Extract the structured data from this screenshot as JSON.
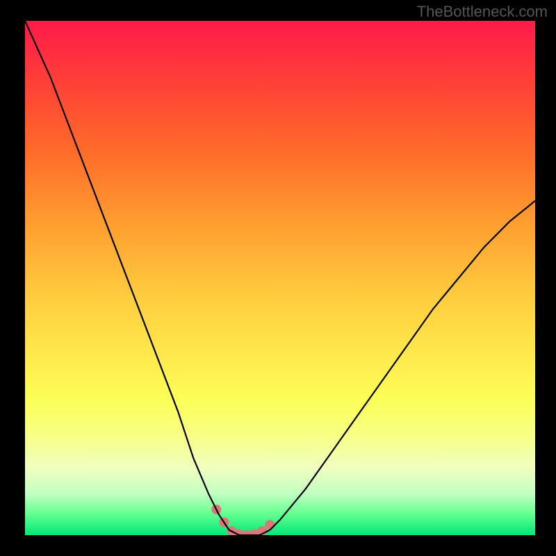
{
  "watermark": "TheBottleneck.com",
  "chart_data": {
    "type": "line",
    "title": "",
    "xlabel": "",
    "ylabel": "",
    "xlim": [
      0,
      100
    ],
    "ylim": [
      0,
      100
    ],
    "grid": false,
    "legend": false,
    "background": {
      "gradient": "vertical",
      "stops": [
        {
          "pos": 0,
          "color": "#ff1a4a"
        },
        {
          "pos": 25,
          "color": "#ff6a2a"
        },
        {
          "pos": 55,
          "color": "#ffd040"
        },
        {
          "pos": 74,
          "color": "#fbff58"
        },
        {
          "pos": 92,
          "color": "#c0ffc0"
        },
        {
          "pos": 100,
          "color": "#00e878"
        }
      ]
    },
    "series": [
      {
        "name": "bottleneck-curve",
        "color": "#000000",
        "x": [
          0,
          5,
          10,
          15,
          20,
          25,
          30,
          33,
          36,
          38,
          40,
          42,
          44,
          46,
          48,
          50,
          55,
          60,
          65,
          70,
          75,
          80,
          85,
          90,
          95,
          100
        ],
        "y": [
          102,
          89,
          76,
          63,
          50,
          37,
          24,
          15,
          8,
          4,
          1,
          0,
          0,
          0,
          1,
          3,
          9,
          16,
          23,
          30,
          37,
          44,
          50,
          56,
          61,
          65
        ]
      }
    ],
    "markers": {
      "name": "bottom-dots",
      "color": "#dd7777",
      "size": 14,
      "points": [
        {
          "x": 37.5,
          "y": 5
        },
        {
          "x": 39,
          "y": 2.5
        },
        {
          "x": 40.5,
          "y": 0.8
        },
        {
          "x": 42,
          "y": 0.2
        },
        {
          "x": 43.5,
          "y": 0
        },
        {
          "x": 45,
          "y": 0.2
        },
        {
          "x": 46.5,
          "y": 0.8
        },
        {
          "x": 48,
          "y": 2
        }
      ]
    }
  }
}
